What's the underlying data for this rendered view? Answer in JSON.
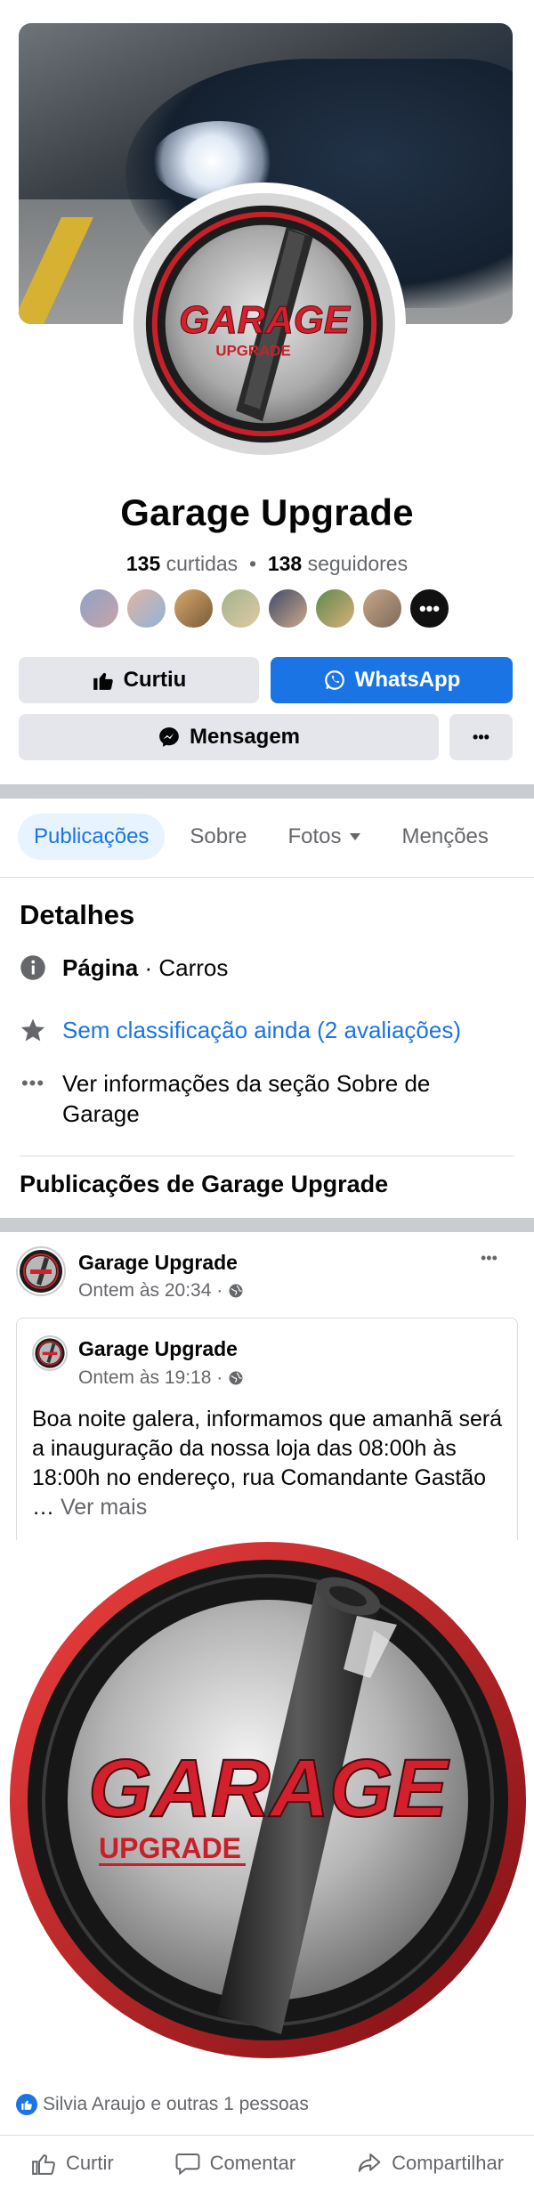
{
  "page": {
    "name": "Garage Upgrade",
    "likes_count": "135",
    "likes_label": "curtidas",
    "separator": "•",
    "followers_count": "138",
    "followers_label": "seguidores",
    "avatar_more": "•••"
  },
  "buttons": {
    "liked": "Curtiu",
    "whatsapp": "WhatsApp",
    "message": "Mensagem",
    "more": "•••"
  },
  "tabs": [
    {
      "label": "Publicações"
    },
    {
      "label": "Sobre"
    },
    {
      "label": "Fotos"
    },
    {
      "label": "Menções"
    }
  ],
  "details": {
    "title": "Detalhes",
    "page_type_bold": "Página",
    "page_type_rest": " · Carros",
    "rating": "Sem classificação ainda (2 avaliações)",
    "about_line1": "Ver informações da seção Sobre de",
    "about_line2": "Garage"
  },
  "posts_section_title": "Publicações de Garage Upgrade",
  "post": {
    "author": "Garage Upgrade",
    "time": "Ontem às 20:34 ·",
    "more": "•••",
    "shared_author": "Garage Upgrade",
    "shared_time": "Ontem às 19:18 ·",
    "text": "Boa noite galera, informamos que amanhã será a inauguração da nossa loja das 08:00h às 18:00h no endereço, rua Comandante Gastão … ",
    "see_more": "Ver mais",
    "logo_text": "GARAGE",
    "logo_sub": "UPGRADE",
    "reactions": "Silvia Araujo e outras 1 pessoas"
  },
  "actions": {
    "like": "Curtir",
    "comment": "Comentar",
    "share": "Compartilhar"
  },
  "colors": {
    "accent": "#1b74e4",
    "logo_red": "#d4202c"
  }
}
